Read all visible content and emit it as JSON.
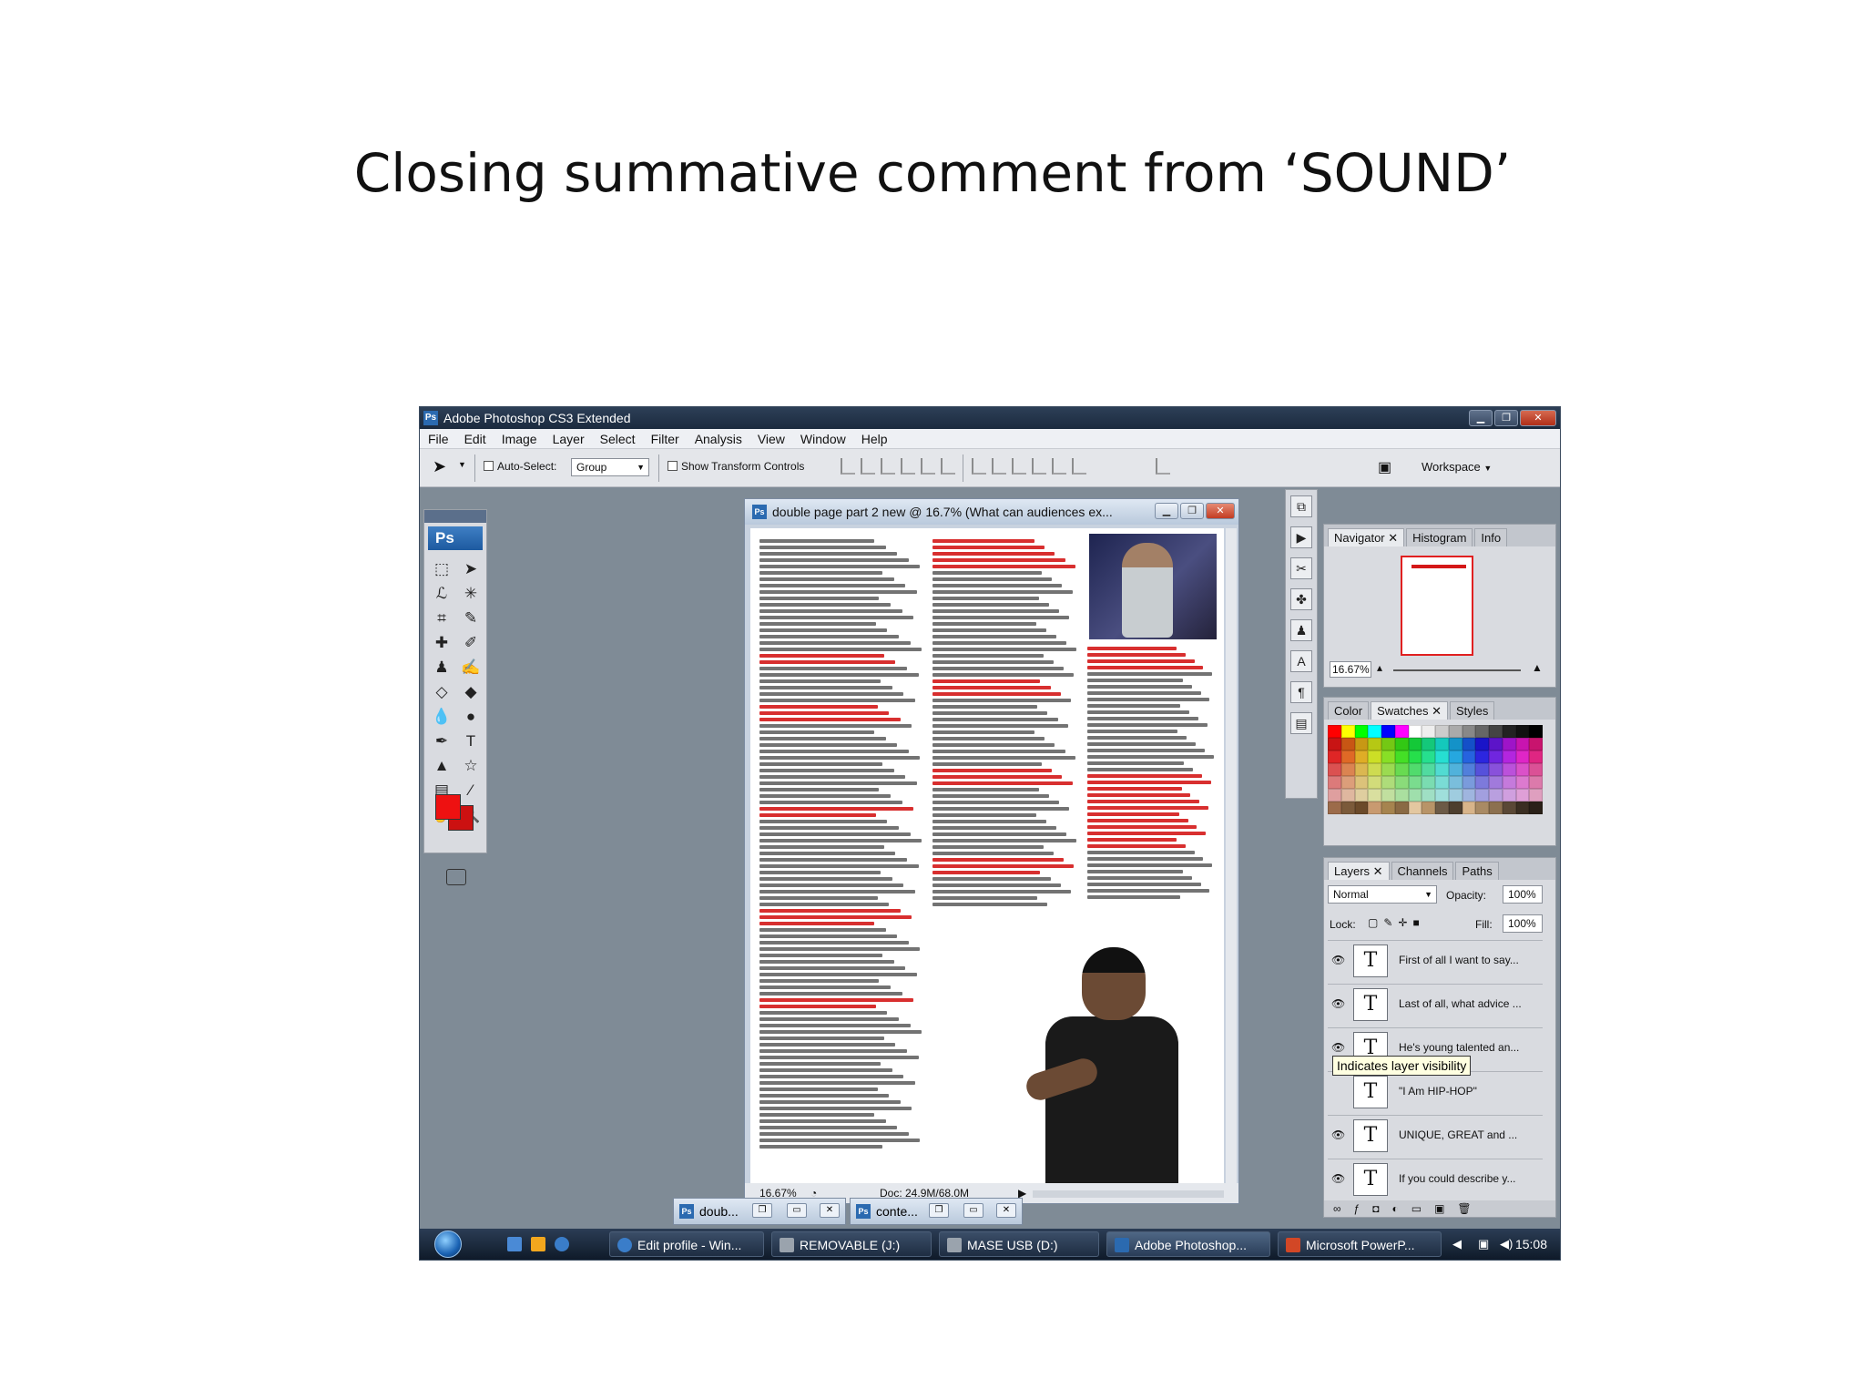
{
  "slide": {
    "title": "Closing summative comment from ‘SOUND’"
  },
  "app": {
    "title": "Adobe Photoshop CS3 Extended",
    "menu": [
      "File",
      "Edit",
      "Image",
      "Layer",
      "Select",
      "Filter",
      "Analysis",
      "View",
      "Window",
      "Help"
    ],
    "options": {
      "auto_select_label": "Auto-Select:",
      "auto_select_value": "Group",
      "show_transform_label": "Show Transform Controls",
      "workspace_label": "Workspace"
    },
    "tools_logo": "Ps",
    "colors": {
      "foreground": "#ee1111",
      "background": "#cc1111"
    }
  },
  "document": {
    "title": "double page part 2 new @ 16.7% (What can audiences ex...",
    "zoom": "16.67%",
    "doc_size": "Doc: 24.9M/68.0M"
  },
  "navigator": {
    "tabs": [
      "Navigator",
      "Histogram",
      "Info"
    ],
    "zoom": "16.67%"
  },
  "color_panel": {
    "tabs": [
      "Color",
      "Swatches",
      "Styles"
    ]
  },
  "layers_panel": {
    "tabs": [
      "Layers",
      "Channels",
      "Paths"
    ],
    "blend_mode": "Normal",
    "opacity_label": "Opacity:",
    "opacity": "100%",
    "lock_label": "Lock:",
    "fill_label": "Fill:",
    "fill": "100%",
    "layers": [
      {
        "name": "First of all I want to say...",
        "visible": true
      },
      {
        "name": "Last of all, what advice ...",
        "visible": true
      },
      {
        "name": "He's young talented an...",
        "visible": true
      },
      {
        "name": "\"I Am HIP-HOP\"",
        "visible": false
      },
      {
        "name": "UNIQUE, GREAT and ...",
        "visible": true
      },
      {
        "name": "If you could describe y...",
        "visible": true
      }
    ],
    "tooltip": "Indicates layer visibility"
  },
  "minimized_docs": [
    {
      "label": "doub..."
    },
    {
      "label": "conte..."
    }
  ],
  "taskbar": {
    "items": [
      {
        "label": "Edit profile - Win...",
        "color": "#3a7dc9"
      },
      {
        "label": "REMOVABLE (J:)",
        "color": "#9aa3ad"
      },
      {
        "label": "MASE USB (D:)",
        "color": "#9aa3ad"
      },
      {
        "label": "Adobe Photoshop...",
        "color": "#2b6ab0"
      },
      {
        "label": "Microsoft PowerP...",
        "color": "#d24726"
      }
    ],
    "clock": "15:08"
  }
}
